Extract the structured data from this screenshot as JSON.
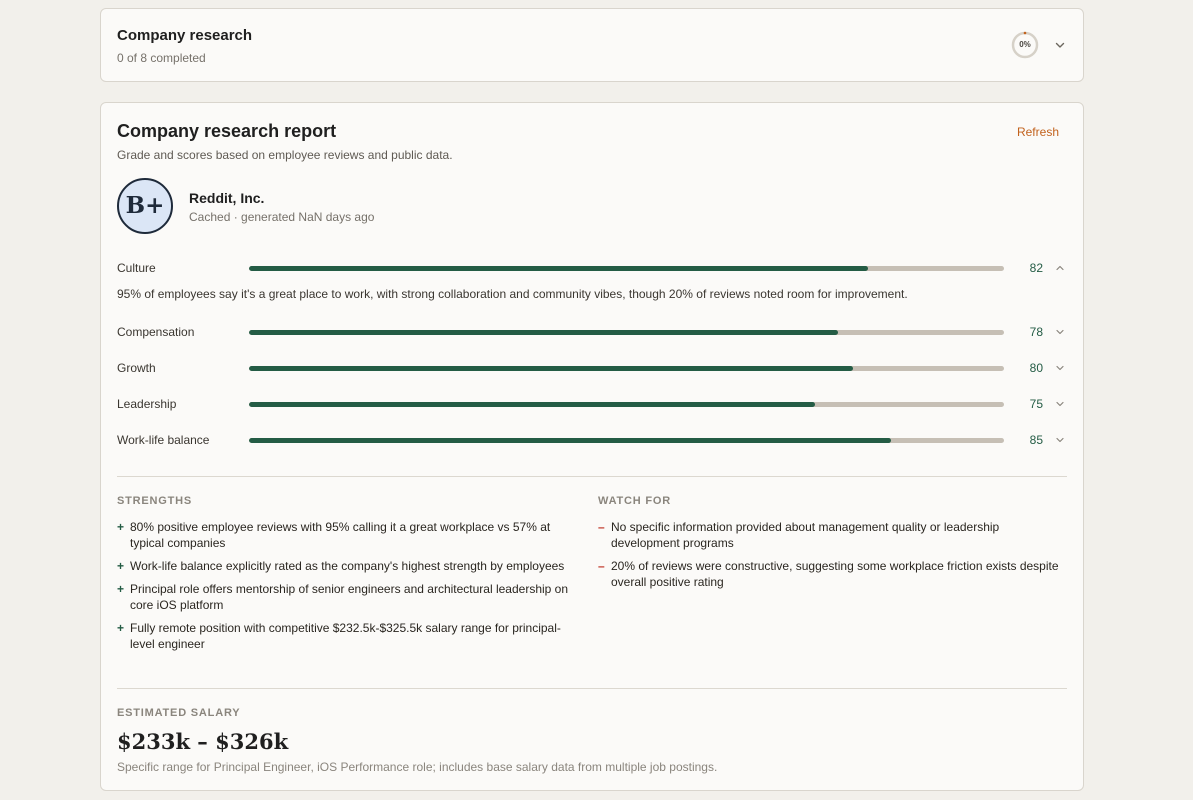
{
  "research_task": {
    "title": "Company research",
    "progress_text": "0 of 8 completed",
    "progress_percent": 0,
    "progress_label": "0%"
  },
  "report": {
    "title": "Company research report",
    "refresh_label": "Refresh",
    "subtitle": "Grade and scores based on employee reviews and public data.",
    "grade": "B+",
    "company_name": "Reddit, Inc.",
    "cache_status": "Cached · generated NaN days ago",
    "metrics": [
      {
        "label": "Culture",
        "score": 82,
        "score_text": "82",
        "expanded": true,
        "description": "95% of employees say it's a great place to work, with strong collaboration and community vibes, though 20% of reviews noted room for improvement."
      },
      {
        "label": "Compensation",
        "score": 78,
        "score_text": "78",
        "expanded": false
      },
      {
        "label": "Growth",
        "score": 80,
        "score_text": "80",
        "expanded": false
      },
      {
        "label": "Leadership",
        "score": 75,
        "score_text": "75",
        "expanded": false
      },
      {
        "label": "Work-life balance",
        "score": 85,
        "score_text": "85",
        "expanded": false
      }
    ],
    "strengths_heading": "STRENGTHS",
    "strengths": [
      "80% positive employee reviews with 95% calling it a great workplace vs 57% at typical companies",
      "Work-life balance explicitly rated as the company's highest strength by employees",
      "Principal role offers mentorship of senior engineers and architectural leadership on core iOS platform",
      "Fully remote position with competitive $232.5k-$325.5k salary range for principal-level engineer"
    ],
    "watch_heading": "WATCH FOR",
    "watch_for": [
      "No specific information provided about management quality or leadership development programs",
      "20% of reviews were constructive, suggesting some workplace friction exists despite overall positive rating"
    ],
    "salary_heading": "ESTIMATED SALARY",
    "salary_range": "$233k – $326k",
    "salary_note": "Specific range for Principal Engineer, iOS Performance role; includes base salary data from multiple job postings."
  },
  "colors": {
    "accent_green": "#245c45",
    "accent_orange": "#c2621d",
    "watch_red": "#c0392b",
    "grade_bg": "#dbe6f6"
  },
  "icons": {
    "expand": "chevron-down-icon",
    "collapse": "chevron-up-icon",
    "strength_mark": "+",
    "watch_mark": "–"
  }
}
